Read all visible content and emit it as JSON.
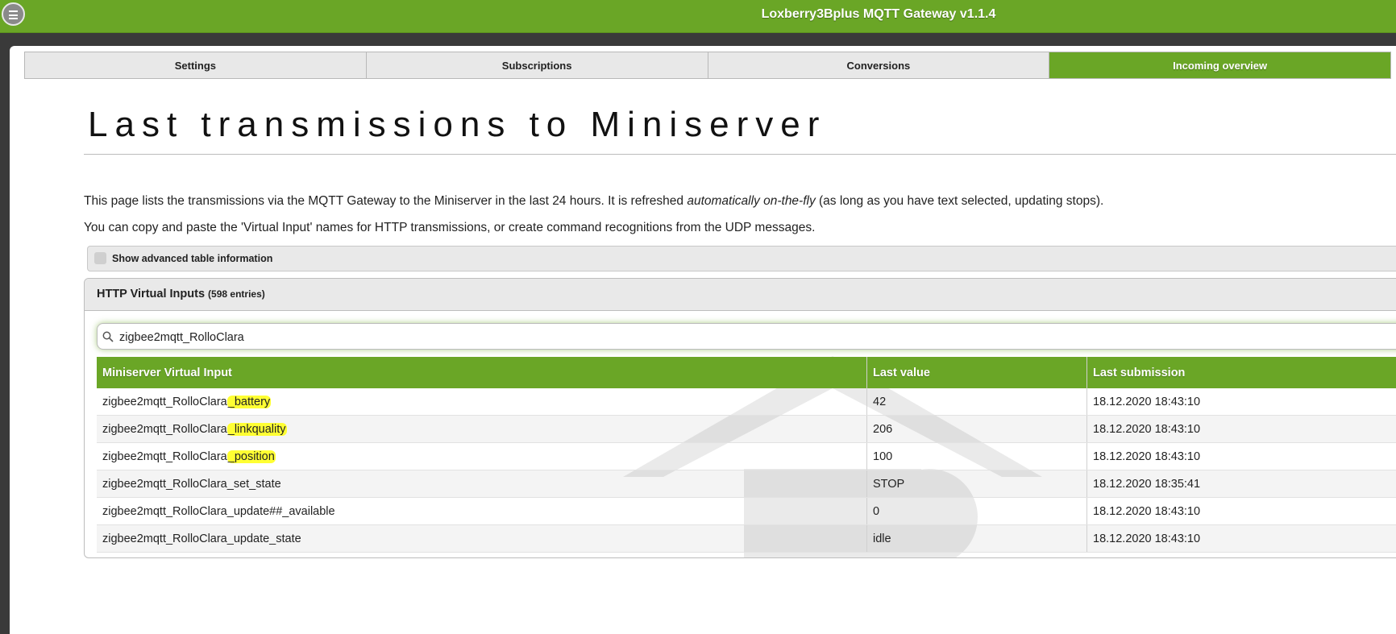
{
  "app": {
    "title": "Loxberry3Bplus MQTT Gateway v1.1.4"
  },
  "tabs": [
    {
      "label": "Settings",
      "active": false
    },
    {
      "label": "Subscriptions",
      "active": false
    },
    {
      "label": "Conversions",
      "active": false
    },
    {
      "label": "Incoming overview",
      "active": true
    }
  ],
  "heading": "Last transmissions to Miniserver",
  "intro": {
    "p1_before": "This page lists the transmissions via the MQTT Gateway to the Miniserver in the last 24 hours. It is refreshed ",
    "p1_em": "automatically on-the-fly",
    "p1_after": " (as long as you have text selected, updating stops).",
    "p2": "You can copy and paste the 'Virtual Input' names for HTTP transmissions, or create command recognitions from the UDP messages."
  },
  "advanced": {
    "label": "Show advanced table information",
    "checked": false
  },
  "panel": {
    "title": "HTTP Virtual Inputs",
    "count": "(598 entries)",
    "search": {
      "value": "zigbee2mqtt_RolloClara"
    }
  },
  "table": {
    "headers": [
      "Miniserver Virtual Input",
      "Last value",
      "Last submission"
    ],
    "rows": [
      {
        "prefix": "zigbee2mqtt_RolloClara",
        "suffix": "_battery",
        "highlight": true,
        "value": "42",
        "time": "18.12.2020 18:43:10"
      },
      {
        "prefix": "zigbee2mqtt_RolloClara",
        "suffix": "_linkquality",
        "highlight": true,
        "value": "206",
        "time": "18.12.2020 18:43:10"
      },
      {
        "prefix": "zigbee2mqtt_RolloClara",
        "suffix": "_position",
        "highlight": true,
        "value": "100",
        "time": "18.12.2020 18:43:10"
      },
      {
        "prefix": "zigbee2mqtt_RolloClara",
        "suffix": "_set_state",
        "highlight": false,
        "value": "STOP",
        "time": "18.12.2020 18:35:41"
      },
      {
        "prefix": "zigbee2mqtt_RolloClara",
        "suffix": "_update##_available",
        "highlight": false,
        "value": "0",
        "time": "18.12.2020 18:43:10"
      },
      {
        "prefix": "zigbee2mqtt_RolloClara",
        "suffix": "_update_state",
        "highlight": false,
        "value": "idle",
        "time": "18.12.2020 18:43:10"
      }
    ]
  },
  "colors": {
    "accent": "#6aa626",
    "highlight": "#ffff33"
  },
  "icons": {
    "menu": "menu-icon",
    "search": "search-icon",
    "watermark": "house-logo-icon"
  }
}
